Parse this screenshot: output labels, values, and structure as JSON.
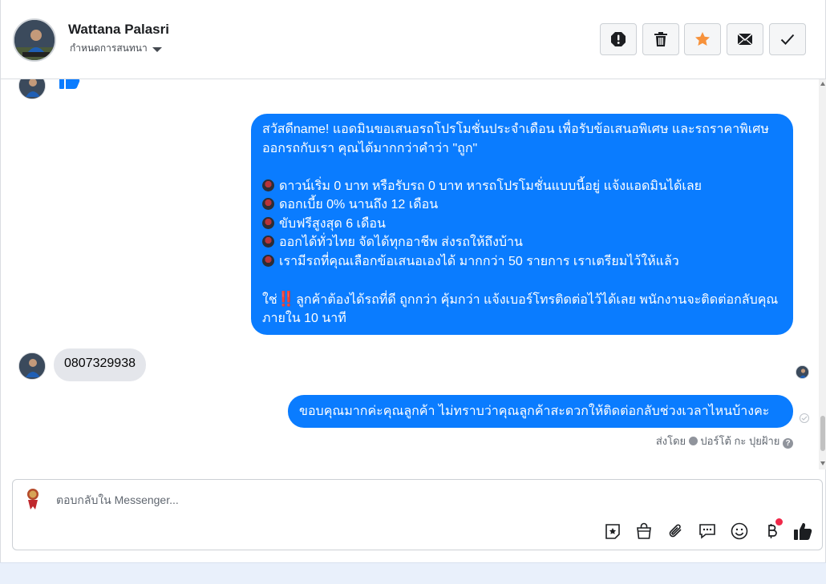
{
  "header": {
    "contact_name": "Wattana Palasri",
    "assign_label": "กำหนดการสนทนา",
    "actions": [
      {
        "icon": "exclamation-icon",
        "label": "Mark as spam"
      },
      {
        "icon": "trash-icon",
        "label": "Delete"
      },
      {
        "icon": "star-icon",
        "label": "Follow up",
        "color": "#f7923b"
      },
      {
        "icon": "envelope-icon",
        "label": "Mark as unread"
      },
      {
        "icon": "check-icon",
        "label": "Mark as done"
      }
    ]
  },
  "messages": {
    "promo": {
      "greeting": "สวัสดีname! แอดมินขอเสนอรถโปรโมชั่นประจำเดือน เพื่อรับข้อเสนอพิเศษ และรถราคาพิเศษ ออกรถกับเรา คุณได้มากกว่าคำว่า \"ถูก\"",
      "bullets": [
        "ดาวน์เริ่ม 0 บาท หรือรับรถ 0 บาท หารถโปรโมชั่นแบบนี้อยู่ แจ้งแอดมินได้เลย",
        "ดอกเบี้ย 0% นานถึง 12 เดือน",
        "ขับฟรีสูงสุด 6 เดือน",
        "ออกได้ทั่วไทย จัดได้ทุกอาชีพ ส่งรถให้ถึงบ้าน",
        "เรามีรถที่คุณเลือกข้อเสนอเองได้ มากกว่า 50 รายการ เราเตรียมไว้ให้แล้ว"
      ],
      "closing_prefix": "ใช่",
      "closing_emoji": "‼️",
      "closing": "ลูกค้าต้องได้รถที่ดี ถูกกว่า คุ้มกว่า แจ้งเบอร์โทรติดต่อไว้ได้เลย พนักงานจะติดต่อกลับคุณภายใน 10 นาที"
    },
    "customer_reply": "0807329938",
    "admin_reply": "ขอบคุณมากค่ะคุณลูกค้า ไม่ทราบว่าคุณลูกค้าสะดวกให้ติดต่อกลับช่วงเวลาไหนบ้างคะ",
    "sent_by_prefix": "ส่งโดย",
    "sent_by_name": "ปอร์โต้ กะ ปุยฝ้าย"
  },
  "composer": {
    "placeholder": "ตอบกลับใน Messenger...",
    "tools": [
      "sticker-icon",
      "shopping-bag-icon",
      "paperclip-icon",
      "saved-reply-icon",
      "emoji-icon",
      "baht-icon",
      "thumbs-up-icon"
    ]
  },
  "colors": {
    "outgoing_bubble": "#0a7cff",
    "incoming_bubble": "#e4e6eb",
    "follow_up_star": "#f7923b",
    "notification_dot": "#f02849"
  }
}
